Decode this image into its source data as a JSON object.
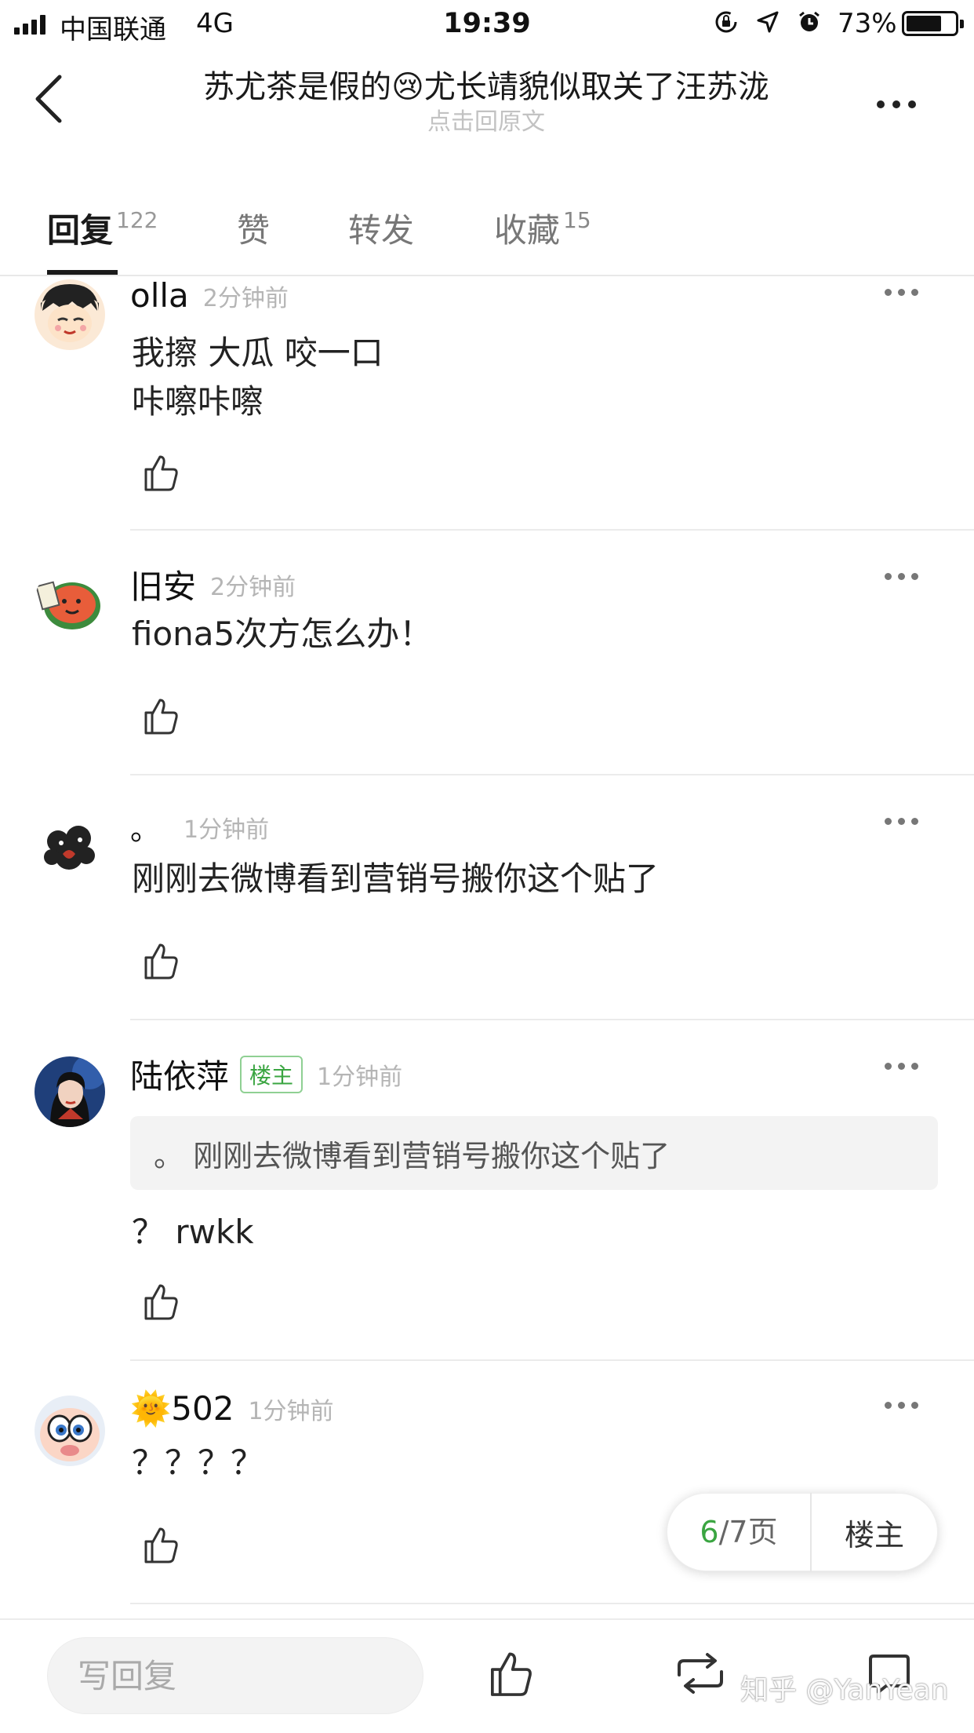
{
  "status_bar": {
    "carrier": "中国联通",
    "network": "4G",
    "time": "19:39",
    "battery_percent": "73%",
    "battery_level": 0.73,
    "icons": [
      "orientation-lock-icon",
      "location-icon",
      "alarm-icon"
    ]
  },
  "nav": {
    "title": "苏尤茶是假的😢尤长靖貌似取关了汪苏泷",
    "subtitle": "点击回原文"
  },
  "tabs": [
    {
      "label": "回复",
      "count": "122",
      "active": true
    },
    {
      "label": "赞",
      "count": "",
      "active": false
    },
    {
      "label": "转发",
      "count": "",
      "active": false
    },
    {
      "label": "收藏",
      "count": "15",
      "active": false
    }
  ],
  "comments": [
    {
      "name": "olla",
      "time": "2分钟前",
      "lines": [
        "我擦 大瓜 咬一口",
        "咔嚓咔嚓"
      ]
    },
    {
      "name": "旧安",
      "time": "2分钟前",
      "lines": [
        "fiona5次方怎么办！"
      ]
    },
    {
      "name": "。",
      "time": "1分钟前",
      "lines": [
        "刚刚去微博看到营销号搬你这个贴了"
      ]
    },
    {
      "name": "陆依萍",
      "badge": "楼主",
      "time": "1分钟前",
      "quote": "。 刚刚去微博看到营销号搬你这个贴了",
      "lines": [
        "？ rwkk"
      ]
    },
    {
      "name": "🌞502",
      "time": "1分钟前",
      "lines": [
        "？？？？"
      ]
    }
  ],
  "pager": {
    "current": "6",
    "total": "/7页",
    "op_label": "楼主"
  },
  "bottom_bar": {
    "reply_placeholder": "写回复",
    "icons": [
      "like-icon",
      "repost-icon",
      "comment-icon"
    ]
  },
  "watermark": "知乎 @YanYean",
  "colors": {
    "accent_green": "#3aa541",
    "text_primary": "#222222",
    "text_secondary": "#b5b5b5"
  }
}
